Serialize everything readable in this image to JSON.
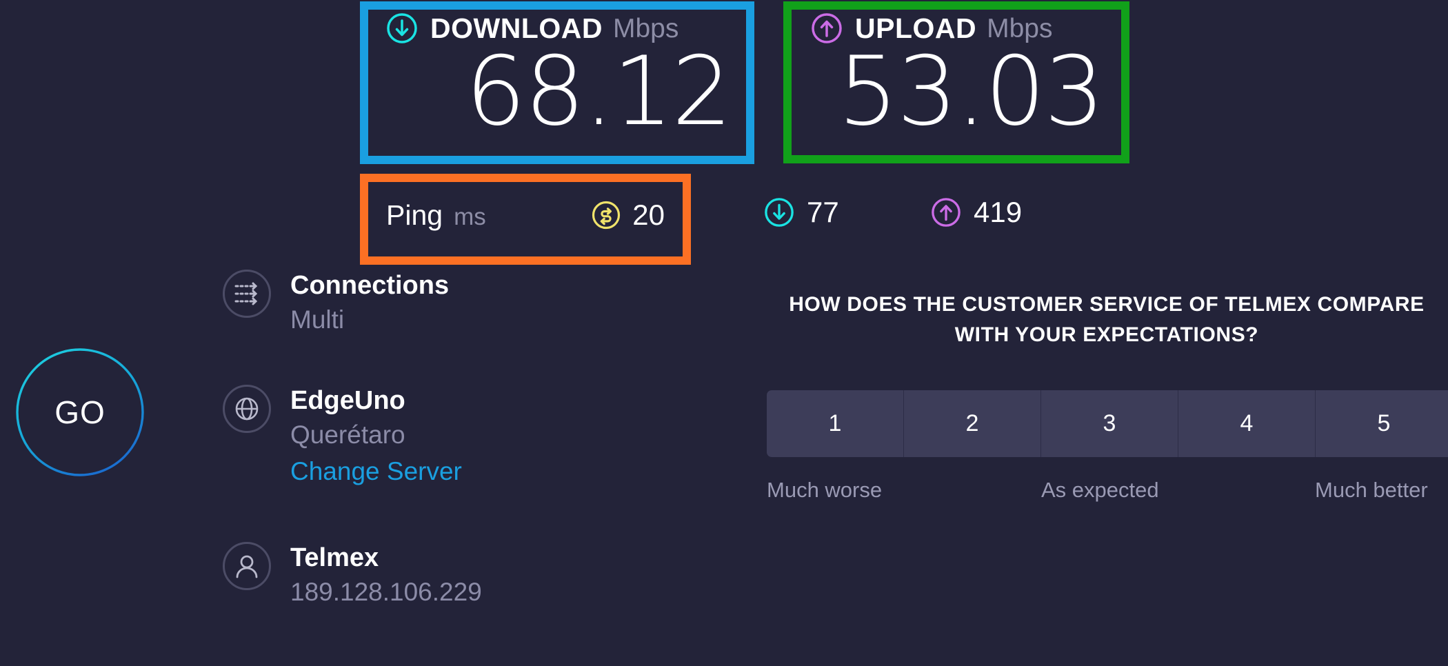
{
  "theme": {
    "background": "#232339",
    "accent_blue": "#1a9fe0",
    "text_primary": "#ffffff",
    "text_secondary": "#8c8ca8",
    "download_color": "#1ae3e3",
    "upload_color": "#cb6ce6",
    "ping_color": "#f0e36b",
    "rating_button_bg": "#3d3d59"
  },
  "annotations": [
    {
      "name": "download-highlight",
      "color": "#1a9fe0"
    },
    {
      "name": "upload-highlight",
      "color": "#11a11a"
    },
    {
      "name": "ping-highlight",
      "color": "#fc7024"
    }
  ],
  "download": {
    "icon": "download-arrow-icon",
    "label": "DOWNLOAD",
    "unit": "Mbps",
    "value": "68.12"
  },
  "upload": {
    "icon": "upload-arrow-icon",
    "label": "UPLOAD",
    "unit": "Mbps",
    "value": "53.03"
  },
  "ping": {
    "label": "Ping",
    "unit": "ms",
    "icon": "idle-latency-icon",
    "value": "20"
  },
  "latency": {
    "download": {
      "icon": "download-arrow-icon",
      "value": "77"
    },
    "upload": {
      "icon": "upload-arrow-icon",
      "value": "419"
    }
  },
  "go_button": {
    "label": "GO"
  },
  "info": {
    "connections": {
      "icon": "connections-icon",
      "title": "Connections",
      "value": "Multi"
    },
    "server": {
      "icon": "globe-icon",
      "title": "EdgeUno",
      "value": "Querétaro",
      "change_link": "Change Server"
    },
    "isp": {
      "icon": "person-icon",
      "title": "Telmex",
      "value": "189.128.106.229"
    }
  },
  "survey": {
    "question": "HOW DOES THE CUSTOMER SERVICE OF TELMEX COMPARE WITH YOUR EXPECTATIONS?",
    "options": [
      "1",
      "2",
      "3",
      "4",
      "5"
    ],
    "scale_labels": [
      "Much worse",
      "As expected",
      "Much better"
    ]
  }
}
